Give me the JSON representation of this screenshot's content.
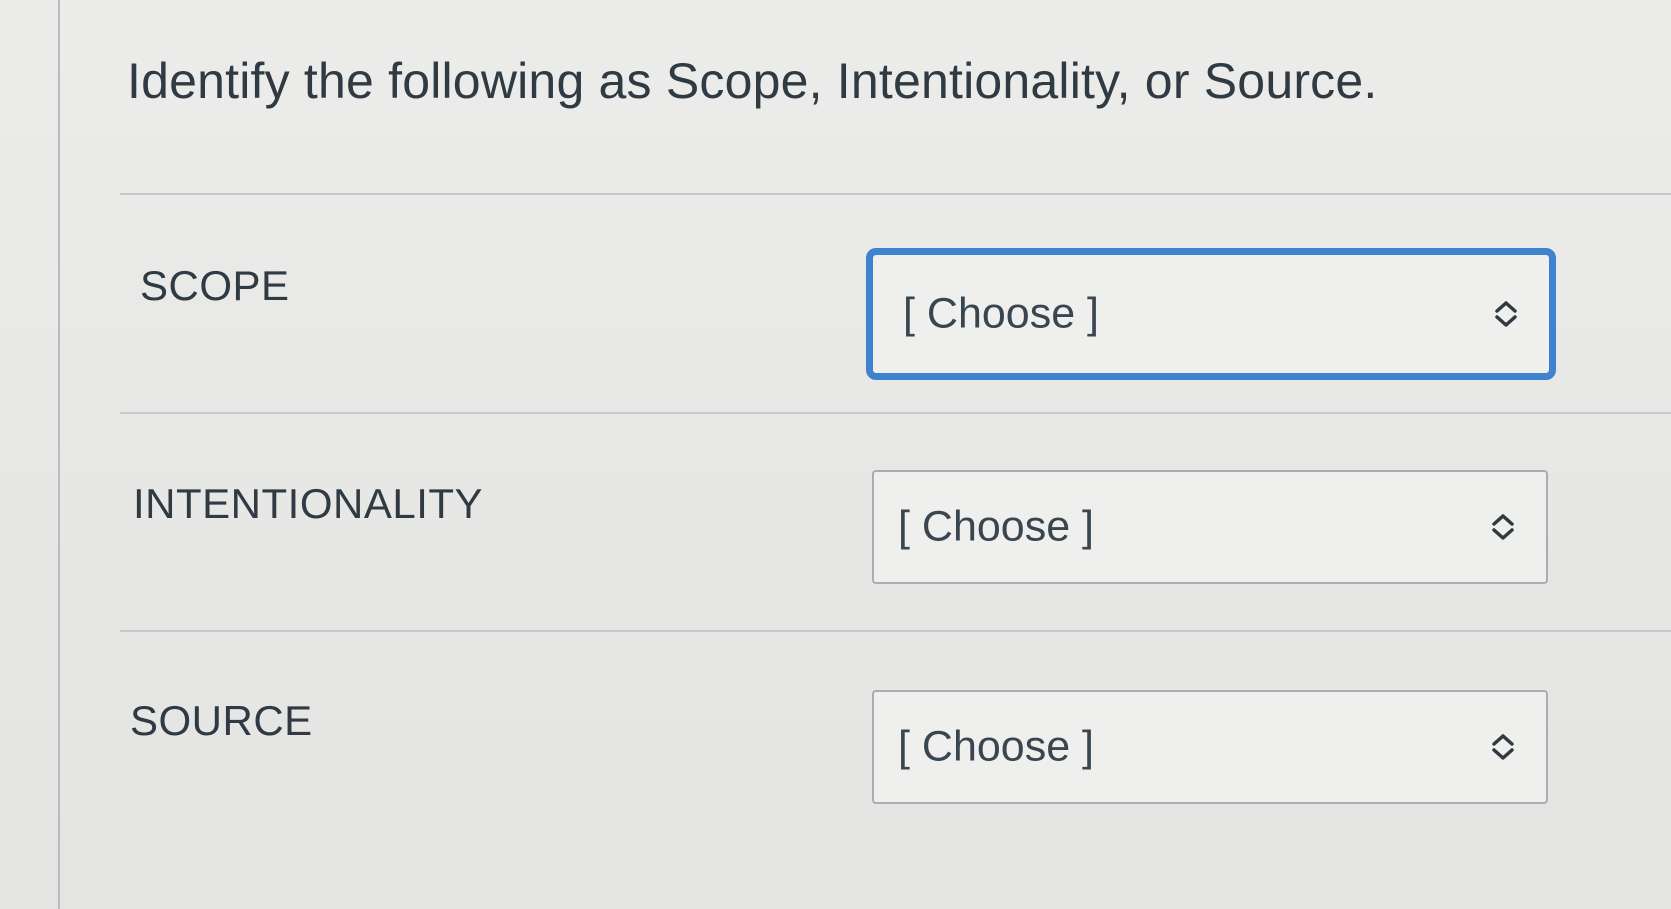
{
  "question": {
    "text": "Identify the following as Scope, Intentionality, or Source."
  },
  "matches": [
    {
      "label": "SCOPE",
      "selected": "[ Choose ]",
      "focused": true
    },
    {
      "label": "INTENTIONALITY",
      "selected": "[ Choose ]",
      "focused": false
    },
    {
      "label": "SOURCE",
      "selected": "[ Choose ]",
      "focused": false
    }
  ],
  "icons": {
    "select_indicator": "chevron-up-down-icon"
  },
  "colors": {
    "focus_border": "#3f83cf",
    "text": "#2f3a43",
    "border": "#a7adb1"
  }
}
